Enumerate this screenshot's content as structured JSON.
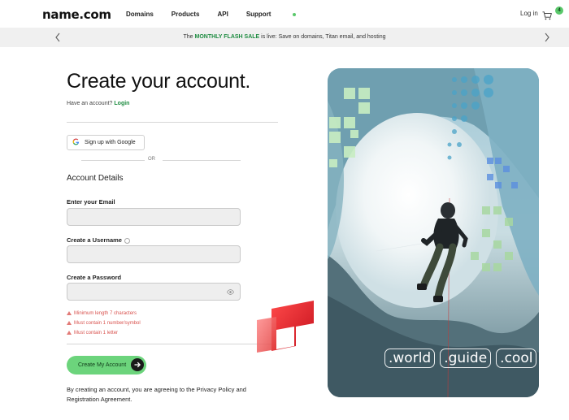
{
  "header": {
    "logo_text": "name.com",
    "nav": [
      "Domains",
      "Products",
      "API",
      "Support"
    ],
    "login": "Log in",
    "cart_count": "4"
  },
  "promo": {
    "prefix": "The ",
    "highlight": "MONTHLY FLASH SALE",
    "suffix": " is live: Save on domains, Titan email, and hosting"
  },
  "form": {
    "title": "Create your account.",
    "have_account": "Have an account?",
    "login_link": "Login",
    "google_button": "Sign up with Google",
    "or": "OR",
    "section_title": "Account Details",
    "email_label": "Enter your Email",
    "email_value": "",
    "username_label": "Create a Username",
    "username_value": "",
    "password_label": "Create a Password",
    "password_value": "",
    "rules": [
      "Minimum length 7 characters",
      "Must contain 1 number/symbol",
      "Must contain 1 letter"
    ],
    "submit": "Create My Account",
    "legal": "By creating an account, you are agreeing to the Privacy Policy and Registration Agreement."
  },
  "hero": {
    "tlds": [
      ".world",
      ".guide",
      ".cool"
    ]
  },
  "colors": {
    "accent_green": "#6cd47c",
    "link_green": "#1e8c41",
    "error_red": "#d9534f"
  }
}
